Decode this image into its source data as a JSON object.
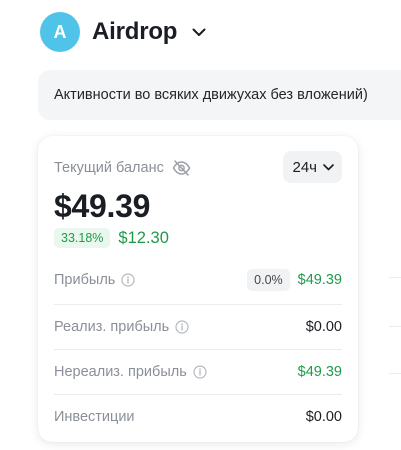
{
  "header": {
    "avatar_letter": "A",
    "portfolio_name": "Airdrop",
    "dropdown_icon": "chevron-down-icon"
  },
  "description": "Активности во всяких движухах без вложений)",
  "balance_card": {
    "label": "Текущий баланс",
    "visibility_icon": "eye-off-icon",
    "period": "24ч",
    "balance": "$49.39",
    "change_percent": "33.18%",
    "change_amount": "$12.30",
    "rows": [
      {
        "label": "Прибыль",
        "badge": "0.0%",
        "value": "$49.39"
      },
      {
        "label": "Реализ. прибыль",
        "value": "$0.00"
      },
      {
        "label": "Нереализ. прибыль",
        "value": "$49.39"
      },
      {
        "label": "Инвестиции",
        "value": "$0.00"
      }
    ]
  },
  "colors": {
    "avatar": "#4fc3e8",
    "positive": "#1f9a4b",
    "positive_bg": "#e9f7ee",
    "muted_text": "#8a8f98",
    "description_bg": "#f4f5f7"
  }
}
